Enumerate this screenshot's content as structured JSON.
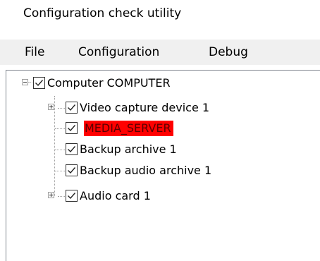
{
  "window": {
    "title": "Configuration check utility"
  },
  "menubar": {
    "items": [
      "File",
      "Configuration",
      "Debug"
    ]
  },
  "tree": {
    "root": {
      "label": "Computer COMPUTER",
      "checked": true,
      "expanded": true
    },
    "children": [
      {
        "label": "Video capture device 1",
        "checked": true,
        "has_children": true,
        "expanded": false,
        "highlighted": false
      },
      {
        "label": "MEDIA_SERVER",
        "checked": true,
        "has_children": false,
        "highlighted": true
      },
      {
        "label": "Backup archive 1",
        "checked": true,
        "has_children": false,
        "highlighted": false
      },
      {
        "label": "Backup audio archive 1",
        "checked": true,
        "has_children": false,
        "highlighted": false
      },
      {
        "label": "Audio card 1",
        "checked": true,
        "has_children": true,
        "expanded": false,
        "highlighted": false
      }
    ]
  },
  "colors": {
    "highlight": "#ff0000",
    "menubar_background": "#f0f0f0"
  }
}
